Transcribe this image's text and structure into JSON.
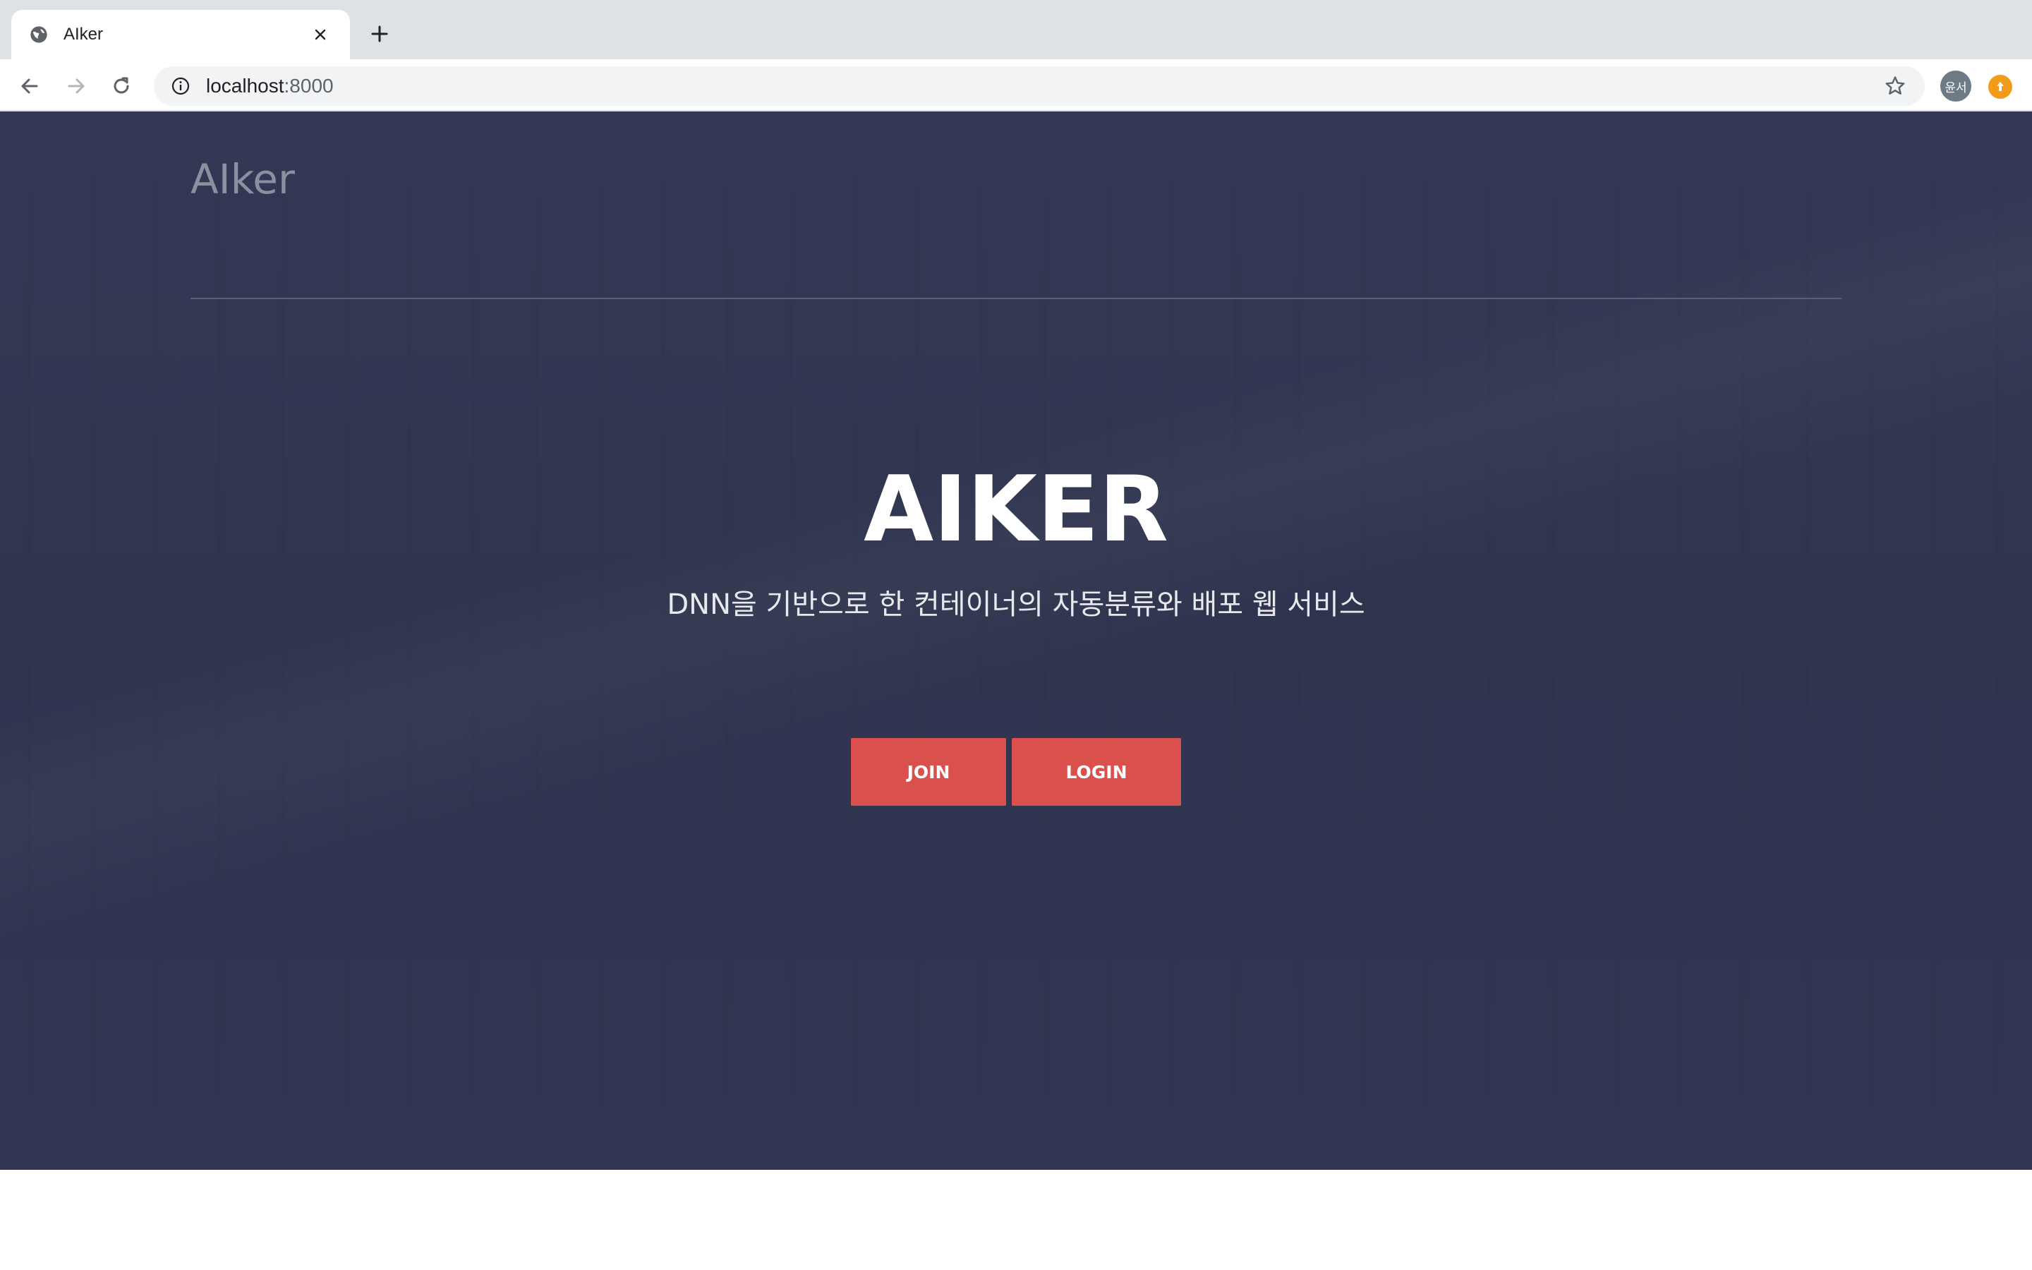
{
  "browser": {
    "tab": {
      "title": "AIker",
      "favicon": "globe-icon"
    },
    "address": {
      "host": "localhost",
      "port": ":8000"
    },
    "profile_initials": "윤서",
    "colors": {
      "tabstrip": "#dee1e6",
      "omnibox": "#f1f3f4",
      "extension": "#f29b1b"
    }
  },
  "page": {
    "brand": "AIker",
    "title": "AIKER",
    "subtitle": "DNN을 기반으로 한 컨테이너의 자동분류와 배포 웹 서비스",
    "buttons": {
      "join": "JOIN",
      "login": "LOGIN"
    },
    "colors": {
      "background": "#30354f",
      "button": "#d9504d"
    }
  }
}
